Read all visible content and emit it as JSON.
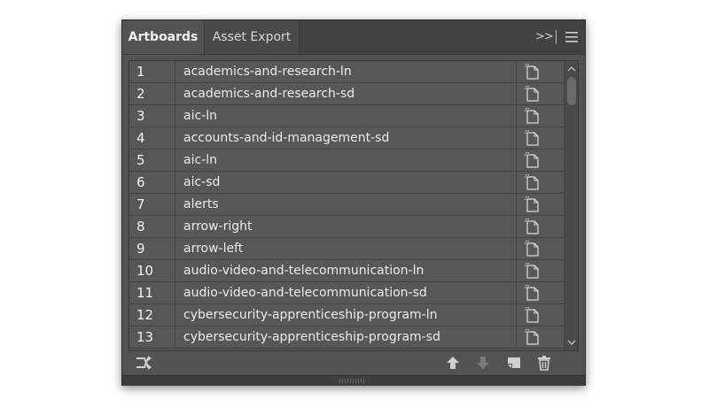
{
  "tabs": [
    {
      "label": "Artboards",
      "active": true
    },
    {
      "label": "Asset Export",
      "active": false
    }
  ],
  "header": {
    "collapse_label": ">>"
  },
  "artboards": [
    {
      "num": "1",
      "name": "academics-and-research-ln"
    },
    {
      "num": "2",
      "name": "academics-and-research-sd"
    },
    {
      "num": "3",
      "name": "aic-ln"
    },
    {
      "num": "4",
      "name": "accounts-and-id-management-sd"
    },
    {
      "num": "5",
      "name": "aic-ln"
    },
    {
      "num": "6",
      "name": "aic-sd"
    },
    {
      "num": "7",
      "name": "alerts"
    },
    {
      "num": "8",
      "name": "arrow-right"
    },
    {
      "num": "9",
      "name": "arrow-left"
    },
    {
      "num": "10",
      "name": "audio-video-and-telecommunication-ln"
    },
    {
      "num": "11",
      "name": "audio-video-and-telecommunication-sd"
    },
    {
      "num": "12",
      "name": "cybersecurity-apprenticeship-program-ln"
    },
    {
      "num": "13",
      "name": "cybersecurity-apprenticeship-program-sd"
    }
  ],
  "colors": {
    "panel_bg": "#535353",
    "tab_bar_bg": "#424242",
    "text": "#ececec",
    "icon": "#d8d8d8",
    "icon_disabled": "#7a7a7a"
  },
  "footer_icons": [
    "rearrange-icon",
    "move-up-icon",
    "move-down-icon",
    "new-artboard-icon",
    "trash-icon"
  ]
}
